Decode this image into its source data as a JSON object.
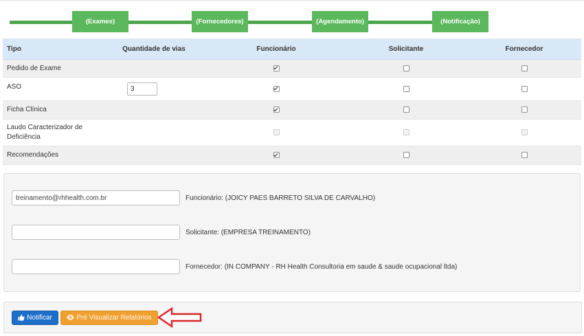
{
  "stepper": {
    "steps": [
      "(Exames)",
      "(Fornecedores)",
      "(Agendamento)",
      "(Notificação)"
    ]
  },
  "table": {
    "headers": [
      "Tipo",
      "Quantidade de vias",
      "Funcionário",
      "Solicitante",
      "Fornecedor"
    ],
    "rows": [
      {
        "tipo": "Pedido de Exame",
        "funcionario": true,
        "solicitante": false,
        "fornecedor": false
      },
      {
        "tipo": "ASO",
        "quantidade": "3",
        "funcionario": true,
        "solicitante": false,
        "fornecedor": false
      },
      {
        "tipo": "Ficha Clínica",
        "funcionario": true,
        "solicitante": false,
        "fornecedor": false
      },
      {
        "tipo_line1": "Laudo Caracterizador de",
        "tipo_line2": "Deficiência",
        "funcionario": false,
        "solicitante": false,
        "fornecedor": false,
        "disabled": true
      },
      {
        "tipo": "Recomendações",
        "funcionario": true,
        "solicitante": false,
        "fornecedor": false
      }
    ]
  },
  "emails": {
    "funcionario": {
      "value": "treinamento@rhhealth.com.br",
      "label": "Funcionário: (JOICY PAES BARRETO SILVA DE CARVALHO)"
    },
    "solicitante": {
      "value": "",
      "label": "Solicitante: (EMPRESA TREINAMENTO)"
    },
    "fornecedor": {
      "value": "",
      "label": "Fornecedor: (IN COMPANY - RH Health Consultoria em saude & saude ocupacional ltda)"
    }
  },
  "actions": {
    "notify_label": "Notificar",
    "preview_label": "Pré Visualizar Relatórios"
  },
  "icons": {
    "notify": "thumbs-up-icon",
    "preview": "eye-icon",
    "annotation": "red-arrow-icon"
  },
  "colors": {
    "step_green": "#5cb85c",
    "header_blue": "#d9e8f7",
    "button_blue": "#1e6fc9",
    "button_orange": "#f0a030",
    "arrow_red": "#d9262b"
  }
}
